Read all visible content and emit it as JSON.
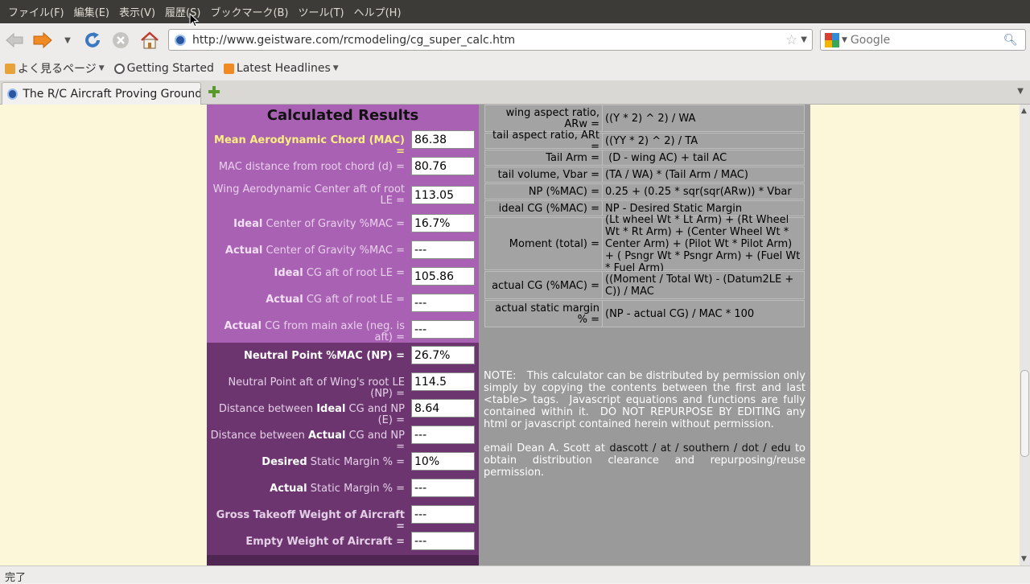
{
  "menu": [
    "ファイル(F)",
    "編集(E)",
    "表示(V)",
    "履歴(S)",
    "ブックマーク(B)",
    "ツール(T)",
    "ヘルプ(H)"
  ],
  "url": "http://www.geistware.com/rcmodeling/cg_super_calc.htm",
  "search": {
    "placeholder": "Google"
  },
  "bookmarks": [
    "よく見るページ",
    "Getting Started",
    "Latest Headlines"
  ],
  "tab": {
    "title": "The R/C Aircraft Proving Ground..."
  },
  "results": {
    "title": "Calculated Results",
    "rows": [
      {
        "label": "Mean Aerodynamic Chord (MAC) =",
        "value": "86.38"
      },
      {
        "label": "MAC distance from root chord (d) =",
        "value": "80.76"
      },
      {
        "label": "Wing Aerodynamic Center aft of root LE =",
        "value": "113.05"
      },
      {
        "label_b": "Ideal",
        "label_rest": " Center of Gravity %MAC =",
        "value": "16.7%"
      },
      {
        "label_b": "Actual",
        "label_rest": " Center of Gravity %MAC =",
        "value": "---"
      },
      {
        "label_b": "Ideal",
        "label_rest": " CG aft of root LE =",
        "value": "105.86"
      },
      {
        "label_b": "Actual",
        "label_rest": " CG aft of root LE =",
        "value": "---"
      },
      {
        "label_b": "Actual",
        "label_rest": " CG from main axle (neg. is aft) =",
        "value": "---"
      },
      {
        "label": "Neutral Point %MAC (NP) =",
        "value": "26.7%"
      },
      {
        "label": "Neutral Point aft of Wing's root LE (NP) =",
        "value": "114.5"
      },
      {
        "label_a": "Distance between ",
        "label_b": "Ideal",
        "label_rest": " CG and NP (E) =",
        "value": "8.64"
      },
      {
        "label_a": "Distance between ",
        "label_b": "Actual",
        "label_rest": " CG and NP =",
        "value": "---"
      },
      {
        "label_b": "Desired",
        "label_rest": " Static Margin % =",
        "value": "10%"
      },
      {
        "label_b": "Actual",
        "label_rest": " Static Margin % =",
        "value": "---"
      },
      {
        "label": "Gross Takeoff Weight of Aircraft =",
        "value": "---"
      },
      {
        "label": "Empty Weight of Aircraft =",
        "value": "---"
      }
    ]
  },
  "formulas": [
    {
      "label": "wing aspect ratio, ARw =",
      "formula": "((Y * 2) ^ 2) / WA"
    },
    {
      "label": "tail aspect ratio, ARt =",
      "formula": "((YY * 2) ^ 2) / TA"
    },
    {
      "label": "Tail Arm =",
      "formula": " (D - wing AC) + tail AC"
    },
    {
      "label": "tail volume, Vbar =",
      "formula": "(TA / WA) * (Tail Arm / MAC)"
    },
    {
      "label": "NP (%MAC) =",
      "formula": "0.25 + (0.25 * sqr(sqr(ARw)) * Vbar"
    },
    {
      "label": "ideal CG (%MAC) =",
      "formula": "NP - Desired Static Margin"
    },
    {
      "label": "Moment (total) =",
      "formula": "(Lt wheel Wt * Lt Arm) + (Rt Wheel Wt * Rt Arm) + (Center Wheel Wt * Center Arm) + (Pilot Wt * Pilot Arm) + ( Psngr Wt * Psngr Arm) + (Fuel Wt * Fuel Arm)"
    },
    {
      "label": "actual CG (%MAC) =",
      "formula": "((Moment / Total Wt) - (Datum2LE + C)) / MAC"
    },
    {
      "label": "actual static margin % =",
      "formula": "(NP - actual CG) / MAC * 100"
    }
  ],
  "note": {
    "text1": "NOTE:   This calculator can be distributed by permission only simply by copying the contents between the first and last <table> tags.  Javascript equations and functions are fully contained within it.  DO NOT REPURPOSE BY EDITING any html or javascript contained herein without permission.",
    "text2a": "email Dean A. Scott at ",
    "email": "dascott / at / southern / dot / edu",
    "text2b": " to obtain distribution clearance and repurposing/reuse permission."
  },
  "status": "完了"
}
